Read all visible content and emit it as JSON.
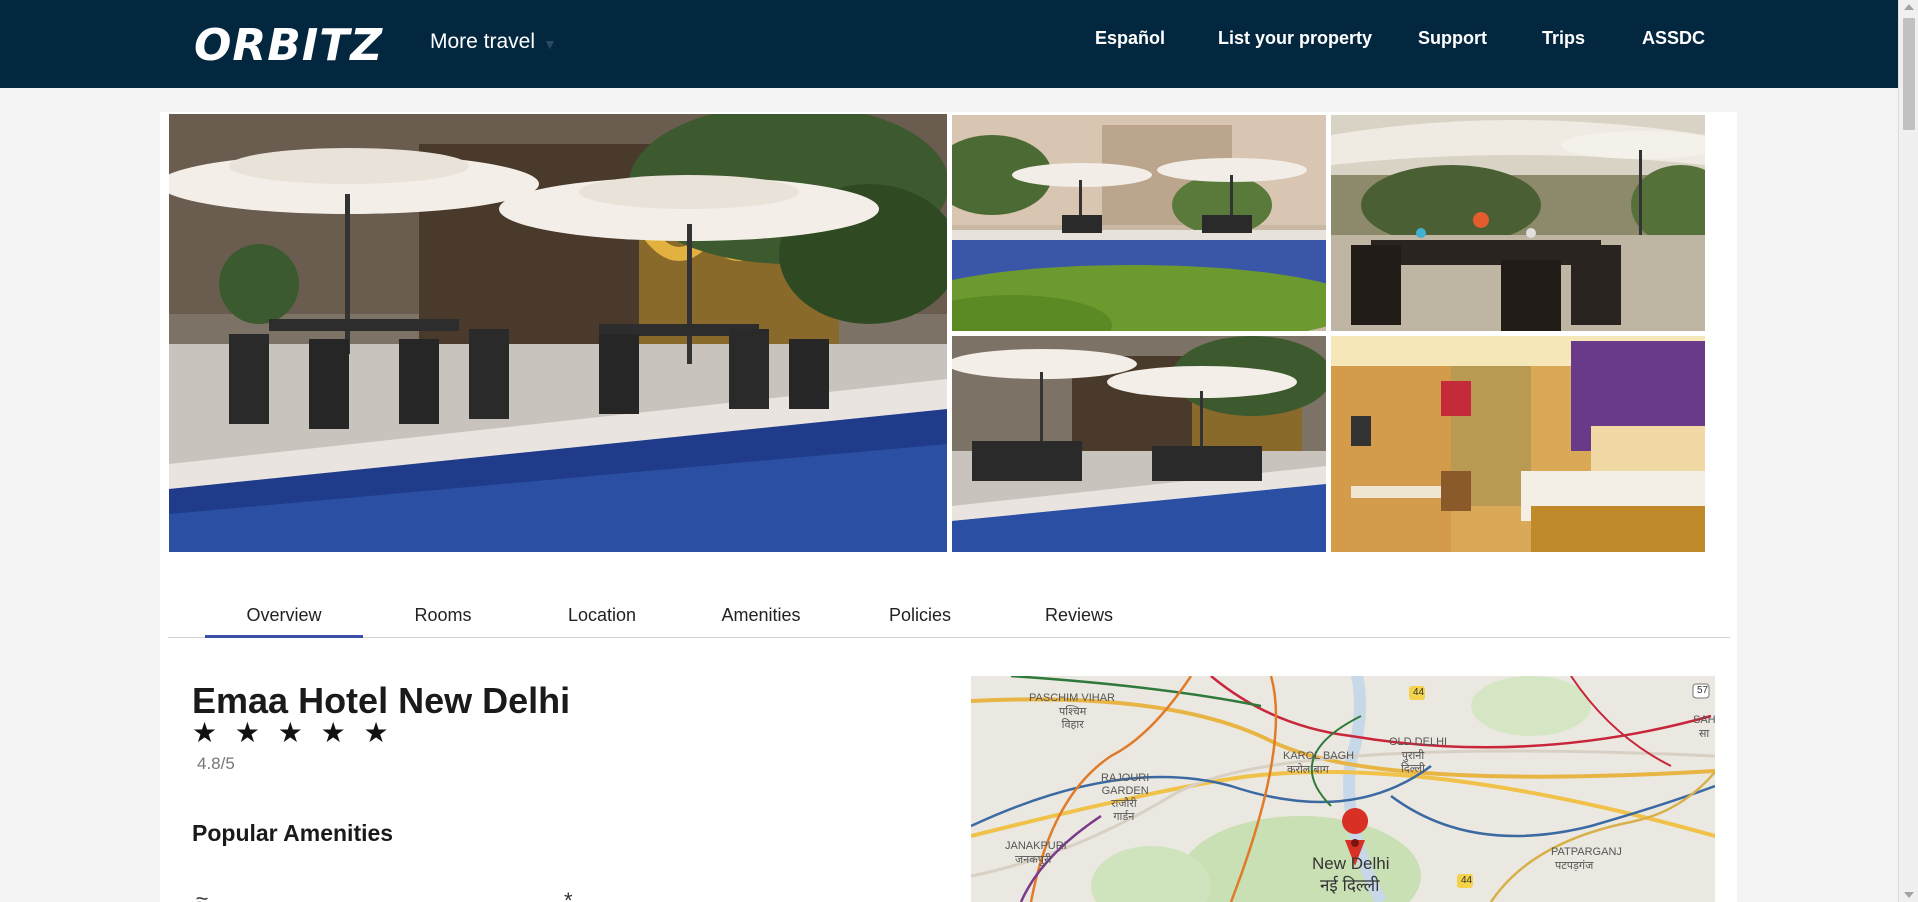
{
  "header": {
    "logo_text": "ORBITZ",
    "more_travel": "More travel",
    "nav": [
      "Español",
      "List your property",
      "Support",
      "Trips",
      "ASSDC"
    ]
  },
  "gallery": {
    "photos": [
      "patio-pool-main",
      "pool-terrace",
      "outdoor-dining",
      "patio-umbrellas",
      "guest-room"
    ]
  },
  "tabs": [
    "Overview",
    "Rooms",
    "Location",
    "Amenities",
    "Policies",
    "Reviews"
  ],
  "hotel": {
    "name": "Emaa Hotel New Delhi",
    "stars": "★ ★ ★ ★ ★",
    "rating": "4.8/5",
    "popular_amenities_title": "Popular Amenities"
  },
  "map": {
    "labels": {
      "paschim_vihar": "PASCHIM VIHAR",
      "paschim_vihar_hi": "पश्चिम\nविहार",
      "karol_bagh": "KAROL BAGH",
      "karol_bagh_hi": "करोल बाग",
      "old_delhi": "OLD DELHI",
      "old_delhi_hi": "पुरानी\nदिल्ली",
      "rajouri": "RAJOURI\nGARDEN",
      "rajouri_hi": "राजौरी\nगार्डन",
      "janakpuri": "JANAKPURI",
      "janakpuri_hi": "जनकपुरी",
      "patparganj": "PATPARGANJ",
      "patparganj_hi": "पटपड़गंज",
      "new_delhi": "New Delhi",
      "new_delhi_hi": "नई दिल्ली",
      "sah": "SAH",
      "sa": "सा",
      "road_44_top": "44",
      "road_44_bottom": "44",
      "road_57": "57"
    }
  },
  "colors": {
    "header_bg": "#042740",
    "tab_active": "#3b4fa8",
    "map_pin": "#d93025"
  }
}
